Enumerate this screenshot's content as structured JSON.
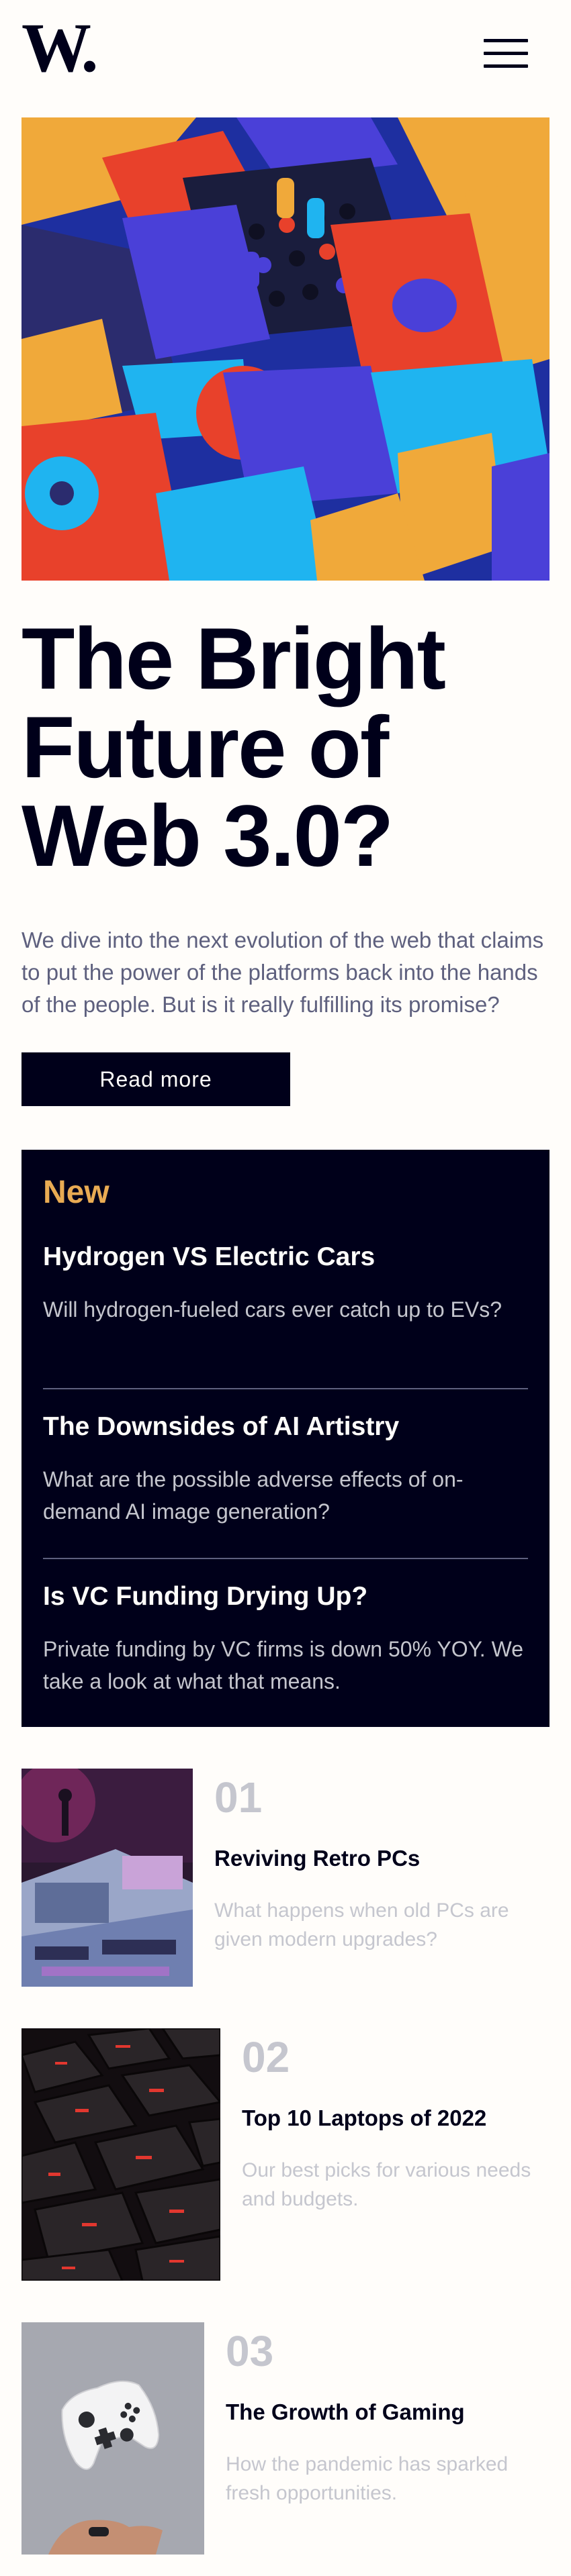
{
  "header": {
    "logo_text": "W.",
    "menu_icon": "hamburger-menu-icon"
  },
  "hero": {
    "image": "colorful-3d-blocks-illustration",
    "title_lines": [
      "The Bright",
      "Future of",
      "Web 3.0?"
    ],
    "description": "We dive into the next evolution of the web that claims to put the power of the platforms back into the hands of the people. But is it really fulfilling its promise?",
    "button_label": "Read more"
  },
  "new_panel": {
    "heading": "New",
    "items": [
      {
        "title": "Hydrogen VS Electric Cars",
        "description": "Will hydrogen-fueled cars ever catch up to EVs?"
      },
      {
        "title": "The Downsides of AI Artistry",
        "description": "What are the possible adverse effects of on-demand AI image generation?"
      },
      {
        "title": "Is VC Funding Drying Up?",
        "description": "Private funding by VC firms is down 50% YOY. We take a look at what that means."
      }
    ]
  },
  "articles": [
    {
      "number": "01",
      "title": "Reviving Retro PCs",
      "description": "What happens when old PCs are given modern upgrades?",
      "image": "retro-pc-photo"
    },
    {
      "number": "02",
      "title": "Top 10 Laptops of 2022",
      "description": "Our best picks for various needs and budgets.",
      "image": "laptop-keyboard-photo"
    },
    {
      "number": "03",
      "title": "The Growth of Gaming",
      "description": "How the pandemic has sparked fresh opportunities.",
      "image": "game-controller-photo"
    }
  ],
  "colors": {
    "dark_navy": "#00001a",
    "off_white": "#fffdfa",
    "soft_orange": "#e9ab53",
    "grayish_blue": "#5e607e",
    "light_gray": "#c5c6ce"
  }
}
